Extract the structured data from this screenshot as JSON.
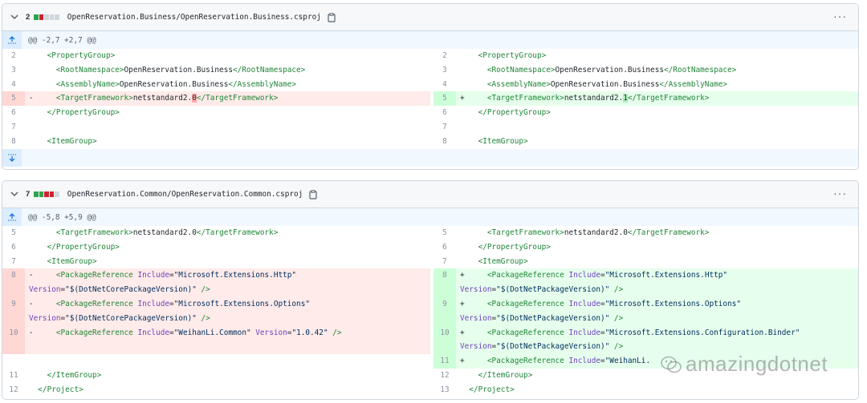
{
  "files": [
    {
      "count": "2",
      "blocks": [
        "#2da44e",
        "#cf222e",
        "#d0d7de",
        "#d0d7de",
        "#d0d7de"
      ],
      "path": "OpenReservation.Business/OpenReservation.Business.csproj",
      "hunk": "@@ -2,7 +2,7 @@",
      "left": [
        {
          "n": "2",
          "type": "ctx",
          "parts": [
            {
              "c": "tag",
              "t": "    <PropertyGroup>"
            }
          ]
        },
        {
          "n": "3",
          "type": "ctx",
          "parts": [
            {
              "c": "tag",
              "t": "      <RootNamespace>"
            },
            {
              "c": "",
              "t": "OpenReservation.Business"
            },
            {
              "c": "tag",
              "t": "</RootNamespace>"
            }
          ]
        },
        {
          "n": "4",
          "type": "ctx",
          "parts": [
            {
              "c": "tag",
              "t": "      <AssemblyName>"
            },
            {
              "c": "",
              "t": "OpenReservation.Business"
            },
            {
              "c": "tag",
              "t": "</AssemblyName>"
            }
          ]
        },
        {
          "n": "5",
          "type": "del",
          "parts": [
            {
              "c": "",
              "t": "-     "
            },
            {
              "c": "tag",
              "t": "<TargetFramework>"
            },
            {
              "c": "",
              "t": "netstandard2."
            },
            {
              "c": "hl-del",
              "t": "0"
            },
            {
              "c": "tag",
              "t": "</TargetFramework>"
            }
          ]
        },
        {
          "n": "6",
          "type": "ctx",
          "parts": [
            {
              "c": "tag",
              "t": "    </PropertyGroup>"
            }
          ]
        },
        {
          "n": "7",
          "type": "ctx",
          "parts": [
            {
              "c": "",
              "t": ""
            }
          ]
        },
        {
          "n": "8",
          "type": "ctx",
          "parts": [
            {
              "c": "tag",
              "t": "    <ItemGroup>"
            }
          ]
        }
      ],
      "right": [
        {
          "n": "2",
          "type": "ctx",
          "parts": [
            {
              "c": "tag",
              "t": "    <PropertyGroup>"
            }
          ]
        },
        {
          "n": "3",
          "type": "ctx",
          "parts": [
            {
              "c": "tag",
              "t": "      <RootNamespace>"
            },
            {
              "c": "",
              "t": "OpenReservation.Business"
            },
            {
              "c": "tag",
              "t": "</RootNamespace>"
            }
          ]
        },
        {
          "n": "4",
          "type": "ctx",
          "parts": [
            {
              "c": "tag",
              "t": "      <AssemblyName>"
            },
            {
              "c": "",
              "t": "OpenReservation.Business"
            },
            {
              "c": "tag",
              "t": "</AssemblyName>"
            }
          ]
        },
        {
          "n": "5",
          "type": "add",
          "parts": [
            {
              "c": "",
              "t": "+     "
            },
            {
              "c": "tag",
              "t": "<TargetFramework>"
            },
            {
              "c": "",
              "t": "netstandard2."
            },
            {
              "c": "hl-add",
              "t": "1"
            },
            {
              "c": "tag",
              "t": "</TargetFramework>"
            }
          ]
        },
        {
          "n": "6",
          "type": "ctx",
          "parts": [
            {
              "c": "tag",
              "t": "    </PropertyGroup>"
            }
          ]
        },
        {
          "n": "7",
          "type": "ctx",
          "parts": [
            {
              "c": "",
              "t": ""
            }
          ]
        },
        {
          "n": "8",
          "type": "ctx",
          "parts": [
            {
              "c": "tag",
              "t": "    <ItemGroup>"
            }
          ]
        }
      ]
    },
    {
      "count": "7",
      "blocks": [
        "#2da44e",
        "#2da44e",
        "#cf222e",
        "#cf222e",
        "#d0d7de"
      ],
      "path": "OpenReservation.Common/OpenReservation.Common.csproj",
      "hunk": "@@ -5,8 +5,9 @@",
      "left": [
        {
          "n": "5",
          "type": "ctx",
          "parts": [
            {
              "c": "tag",
              "t": "      <TargetFramework>"
            },
            {
              "c": "",
              "t": "netstandard2.0"
            },
            {
              "c": "tag",
              "t": "</TargetFramework>"
            }
          ]
        },
        {
          "n": "6",
          "type": "ctx",
          "parts": [
            {
              "c": "tag",
              "t": "    </PropertyGroup>"
            }
          ]
        },
        {
          "n": "7",
          "type": "ctx",
          "parts": [
            {
              "c": "tag",
              "t": "    <ItemGroup>"
            }
          ]
        },
        {
          "n": "8",
          "type": "del",
          "parts": [
            {
              "c": "",
              "t": "-     "
            },
            {
              "c": "tag",
              "t": "<PackageReference "
            },
            {
              "c": "attr",
              "t": "Include"
            },
            {
              "c": "",
              "t": "="
            },
            {
              "c": "str",
              "t": "\"Microsoft.Extensions.Http\""
            }
          ]
        },
        {
          "n": "",
          "type": "del",
          "parts": [
            {
              "c": "attr",
              "t": "Version"
            },
            {
              "c": "",
              "t": "="
            },
            {
              "c": "str",
              "t": "\"$(DotNetCorePackageVersion)\""
            },
            {
              "c": "tag",
              "t": " />"
            }
          ]
        },
        {
          "n": "9",
          "type": "del",
          "parts": [
            {
              "c": "",
              "t": "-     "
            },
            {
              "c": "tag",
              "t": "<PackageReference "
            },
            {
              "c": "attr",
              "t": "Include"
            },
            {
              "c": "",
              "t": "="
            },
            {
              "c": "str",
              "t": "\"Microsoft.Extensions.Options\""
            }
          ]
        },
        {
          "n": "",
          "type": "del",
          "parts": [
            {
              "c": "attr",
              "t": "Version"
            },
            {
              "c": "",
              "t": "="
            },
            {
              "c": "str",
              "t": "\"$(DotNetCorePackageVersion)\""
            },
            {
              "c": "tag",
              "t": " />"
            }
          ]
        },
        {
          "n": "10",
          "type": "del",
          "parts": [
            {
              "c": "",
              "t": "-     "
            },
            {
              "c": "tag",
              "t": "<PackageReference "
            },
            {
              "c": "attr",
              "t": "Include"
            },
            {
              "c": "",
              "t": "="
            },
            {
              "c": "str",
              "t": "\"WeihanLi.Common\" "
            },
            {
              "c": "attr",
              "t": "Version"
            },
            {
              "c": "",
              "t": "="
            },
            {
              "c": "str",
              "t": "\"1.0.42\""
            },
            {
              "c": "tag",
              "t": " />"
            }
          ]
        },
        {
          "n": "",
          "type": "del",
          "parts": [
            {
              "c": "",
              "t": ""
            }
          ]
        },
        {
          "n": "",
          "type": "blank",
          "parts": [
            {
              "c": "",
              "t": ""
            }
          ]
        },
        {
          "n": "11",
          "type": "ctx",
          "parts": [
            {
              "c": "tag",
              "t": "    </ItemGroup>"
            }
          ]
        },
        {
          "n": "12",
          "type": "ctx",
          "parts": [
            {
              "c": "tag",
              "t": "  </Project>"
            }
          ]
        }
      ],
      "right": [
        {
          "n": "5",
          "type": "ctx",
          "parts": [
            {
              "c": "tag",
              "t": "      <TargetFramework>"
            },
            {
              "c": "",
              "t": "netstandard2.0"
            },
            {
              "c": "tag",
              "t": "</TargetFramework>"
            }
          ]
        },
        {
          "n": "6",
          "type": "ctx",
          "parts": [
            {
              "c": "tag",
              "t": "    </PropertyGroup>"
            }
          ]
        },
        {
          "n": "7",
          "type": "ctx",
          "parts": [
            {
              "c": "tag",
              "t": "    <ItemGroup>"
            }
          ]
        },
        {
          "n": "8",
          "type": "add",
          "parts": [
            {
              "c": "",
              "t": "+     "
            },
            {
              "c": "tag",
              "t": "<PackageReference "
            },
            {
              "c": "attr",
              "t": "Include"
            },
            {
              "c": "",
              "t": "="
            },
            {
              "c": "str",
              "t": "\"Microsoft.Extensions.Http\""
            }
          ]
        },
        {
          "n": "",
          "type": "add",
          "parts": [
            {
              "c": "attr",
              "t": "Version"
            },
            {
              "c": "",
              "t": "="
            },
            {
              "c": "str",
              "t": "\"$(DotNetPackageVersion)\""
            },
            {
              "c": "tag",
              "t": " />"
            }
          ]
        },
        {
          "n": "9",
          "type": "add",
          "parts": [
            {
              "c": "",
              "t": "+     "
            },
            {
              "c": "tag",
              "t": "<PackageReference "
            },
            {
              "c": "attr",
              "t": "Include"
            },
            {
              "c": "",
              "t": "="
            },
            {
              "c": "str",
              "t": "\"Microsoft.Extensions.Options\""
            }
          ]
        },
        {
          "n": "",
          "type": "add",
          "parts": [
            {
              "c": "attr",
              "t": "Version"
            },
            {
              "c": "",
              "t": "="
            },
            {
              "c": "str",
              "t": "\"$(DotNetPackageVersion)\""
            },
            {
              "c": "tag",
              "t": " />"
            }
          ]
        },
        {
          "n": "10",
          "type": "add",
          "parts": [
            {
              "c": "",
              "t": "+     "
            },
            {
              "c": "tag",
              "t": "<PackageReference "
            },
            {
              "c": "attr",
              "t": "Include"
            },
            {
              "c": "",
              "t": "="
            },
            {
              "c": "str",
              "t": "\"Microsoft.Extensions.Configuration.Binder\""
            }
          ]
        },
        {
          "n": "",
          "type": "add",
          "parts": [
            {
              "c": "attr",
              "t": "Version"
            },
            {
              "c": "",
              "t": "="
            },
            {
              "c": "str",
              "t": "\"$(DotNetPackageVersion)\""
            },
            {
              "c": "tag",
              "t": " />"
            }
          ]
        },
        {
          "n": "11",
          "type": "add",
          "parts": [
            {
              "c": "",
              "t": "+     "
            },
            {
              "c": "tag",
              "t": "<PackageReference "
            },
            {
              "c": "attr",
              "t": "Include"
            },
            {
              "c": "",
              "t": "="
            },
            {
              "c": "str",
              "t": "\"WeihanLi."
            }
          ]
        },
        {
          "n": "12",
          "type": "ctx",
          "parts": [
            {
              "c": "tag",
              "t": "    </ItemGroup>"
            }
          ]
        },
        {
          "n": "13",
          "type": "ctx",
          "parts": [
            {
              "c": "tag",
              "t": "  </Project>"
            }
          ]
        }
      ]
    }
  ],
  "watermark": "amazingdotnet"
}
